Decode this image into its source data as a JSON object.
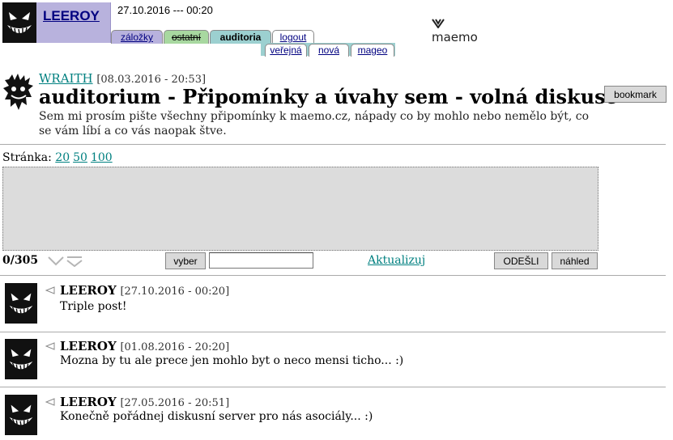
{
  "header": {
    "username": "LEEROY",
    "datetime": "27.10.2016 --- 00:20",
    "logo_text": "maemo",
    "tabs": [
      {
        "label": "záložky"
      },
      {
        "label": "ostatní"
      },
      {
        "label": "auditoria"
      },
      {
        "label": "logout"
      }
    ],
    "subtabs": [
      {
        "label": "veřejná"
      },
      {
        "label": "nová"
      },
      {
        "label": "mageo"
      }
    ]
  },
  "topic": {
    "author": "WRAITH",
    "date": "[08.03.2016 - 20:53]",
    "title": "auditorium - Připomínky a úvahy sem - volná diskuse",
    "description": "Sem mi prosím pište všechny připomínky k maemo.cz, nápady co by mohlo nebo nemělo být, co se vám líbí a co vás naopak štve.",
    "bookmark_label": "bookmark"
  },
  "pager": {
    "label": "Stránka:",
    "options": [
      "20",
      "50",
      "100"
    ]
  },
  "editor": {
    "counter": "0/305",
    "choose_label": "vyber",
    "refresh_label": "Aktualizuj",
    "send_label": "ODEŠLI",
    "preview_label": "náhled"
  },
  "posts": [
    {
      "author": "LEEROY",
      "date": "[27.10.2016 - 00:20]",
      "text": "Triple post!"
    },
    {
      "author": "LEEROY",
      "date": "[01.08.2016 - 20:20]",
      "text": "Mozna by tu ale prece jen mohlo byt o neco mensi ticho... :)"
    },
    {
      "author": "LEEROY",
      "date": "[27.05.2016 - 20:51]",
      "text": "Konečně pořádnej diskusní server pro nás asociály... :)"
    }
  ],
  "icons": {
    "avatar": "grinning-face-icon",
    "topic_avatar": "scribble-face-icon",
    "reply": "reply-triangle-icon",
    "arrows": "chevron-down-icon"
  },
  "colors": {
    "link": "#008080",
    "user_box": "#b8b2dd",
    "tab_active": "#9cd0d0",
    "tab_ostatni": "#a8d8a0",
    "editor_bg": "#dcdcdc"
  }
}
